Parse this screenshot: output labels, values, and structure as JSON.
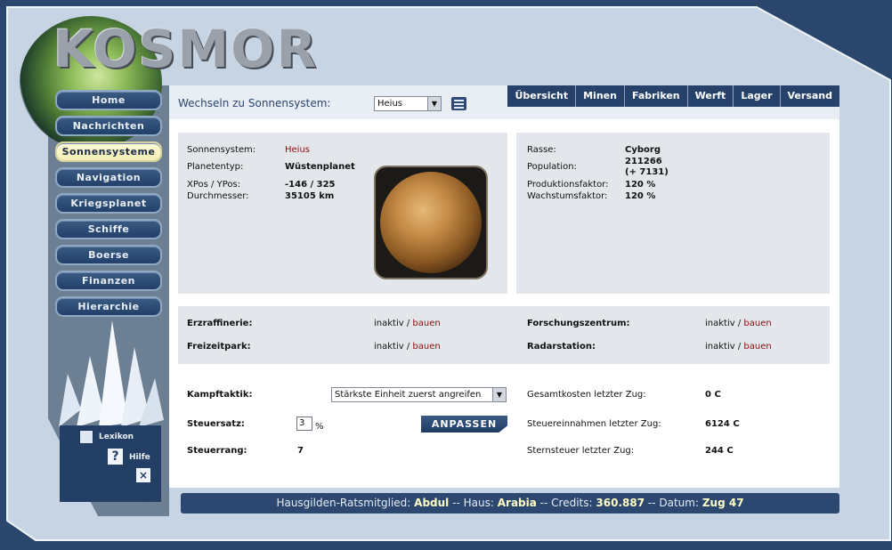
{
  "logo": "KOSMOR",
  "nav": [
    {
      "label": "Home",
      "active": false
    },
    {
      "label": "Nachrichten",
      "active": false
    },
    {
      "label": "Sonnensysteme",
      "active": true
    },
    {
      "label": "Navigation",
      "active": false
    },
    {
      "label": "Kriegsplanet",
      "active": false
    },
    {
      "label": "Schiffe",
      "active": false
    },
    {
      "label": "Boerse",
      "active": false
    },
    {
      "label": "Finanzen",
      "active": false
    },
    {
      "label": "Hierarchie",
      "active": false
    }
  ],
  "help": {
    "lexikon": "Lexikon",
    "hilfe": "Hilfe"
  },
  "topbar": {
    "switch_label": "Wechseln zu Sonnensystem:",
    "system_value": "Heius",
    "tabs": [
      "Übersicht",
      "Minen",
      "Fabriken",
      "Werft",
      "Lager",
      "Versand"
    ]
  },
  "planet": {
    "system_label": "Sonnensystem:",
    "system_value": "Heius",
    "type_label": "Planetentyp:",
    "type_value": "Wüstenplanet",
    "pos_label": "XPos / YPos:",
    "pos_value": "-146 / 325",
    "diameter_label": "Durchmesser:",
    "diameter_value": "35105 km"
  },
  "race": {
    "race_label": "Rasse:",
    "race_value": "Cyborg",
    "pop_label": "Population:",
    "pop_value": "211266",
    "pop_growth": "(+ 7131)",
    "prod_label": "Produktionsfaktor:",
    "prod_value": "120 %",
    "growth_label": "Wachstumsfaktor:",
    "growth_value": "120 %"
  },
  "buildings": [
    {
      "name": "Erzraffinerie:",
      "status": "inaktiv",
      "sep": " / ",
      "action": "bauen"
    },
    {
      "name": "Forschungszentrum:",
      "status": "inaktiv",
      "sep": " / ",
      "action": "bauen"
    },
    {
      "name": "Freizeitpark:",
      "status": "inaktiv",
      "sep": " / ",
      "action": "bauen"
    },
    {
      "name": "Radarstation:",
      "status": "inaktiv",
      "sep": " / ",
      "action": "bauen"
    }
  ],
  "settings": {
    "tactic_label": "Kampftaktik:",
    "tactic_value": "Stärkste Einheit zuerst angreifen",
    "tax_label": "Steuersatz:",
    "tax_value": "3",
    "tax_unit": "%",
    "adjust_button": "ANPASSEN",
    "rank_label": "Steuerrang:",
    "rank_value": "7"
  },
  "finance": {
    "cost_label": "Gesamtkosten letzter Zug:",
    "cost_value": "0 C",
    "income_label": "Steuereinnahmen letzter Zug:",
    "income_value": "6124 C",
    "startax_label": "Sternsteuer letzter Zug:",
    "startax_value": "244 C"
  },
  "status": {
    "rank_label": "Hausgilden-Ratsmitglied:",
    "name": "Abdul",
    "house_label": "Haus:",
    "house": "Arabia",
    "credits_label": "Credits:",
    "credits": "360.887",
    "date_label": "Datum:",
    "date": "Zug 47",
    "sep": "--"
  }
}
